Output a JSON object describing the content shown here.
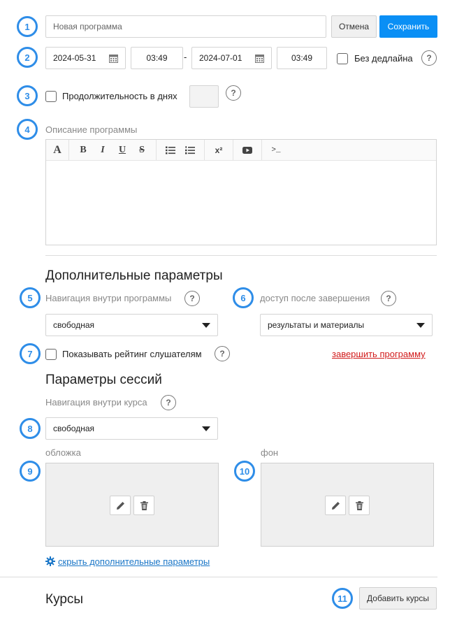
{
  "markers": [
    "1",
    "2",
    "3",
    "4",
    "5",
    "6",
    "7",
    "8",
    "9",
    "10",
    "11"
  ],
  "header": {
    "name_placeholder": "Новая программа",
    "cancel_label": "Отмена",
    "save_label": "Сохранить"
  },
  "dates": {
    "start_date": "2024-05-31",
    "start_time": "03:49",
    "separator": "-",
    "end_date": "2024-07-01",
    "end_time": "03:49",
    "no_deadline_label": "Без дедлайна"
  },
  "duration": {
    "label": "Продолжительность в днях",
    "value": ""
  },
  "description": {
    "label": "Описание программы",
    "toolbar": {
      "font": "A",
      "bold": "B",
      "italic": "I",
      "underline": "U",
      "strike": "S",
      "superscript": "x²",
      "code": ">_"
    }
  },
  "additional": {
    "heading": "Дополнительные параметры",
    "nav_label": "Навигация внутри программы",
    "nav_value": "свободная",
    "access_label": "доступ после завершения",
    "access_value": "результаты и материалы",
    "rating_label": "Показывать рейтинг слушателям",
    "finish_link": "завершить программу"
  },
  "sessions": {
    "heading": "Параметры сессий",
    "nav_label": "Навигация внутри курса",
    "nav_value": "свободная",
    "cover_label": "обложка",
    "background_label": "фон",
    "hide_link": "скрыть дополнительные параметры"
  },
  "courses": {
    "heading": "Курсы",
    "add_label": "Добавить курсы"
  },
  "help_glyph": "?",
  "icons": {
    "calendar": "calendar-icon",
    "edit": "pencil-icon",
    "delete": "trash-icon",
    "settings": "gear-icon"
  },
  "colors": {
    "accent": "#2e8de8",
    "primary_button": "#0a8ff5",
    "danger_link": "#d11a1a",
    "link": "#1a76c7"
  }
}
